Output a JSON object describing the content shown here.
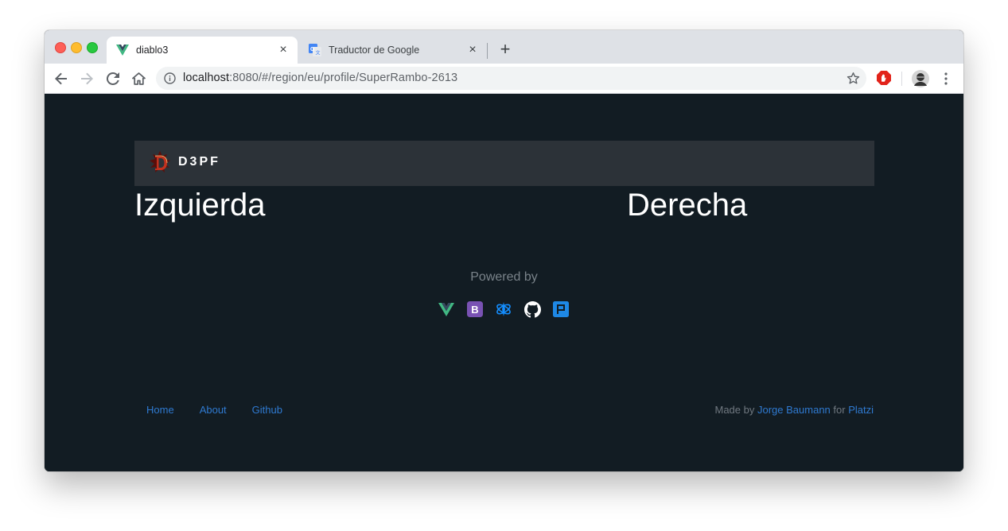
{
  "browser": {
    "tabs": [
      {
        "title": "diablo3",
        "favicon": "vue-icon",
        "active": true
      },
      {
        "title": "Traductor de Google",
        "favicon": "google-translate-icon",
        "active": false
      }
    ],
    "url": {
      "host": "localhost",
      "rest": ":8080/#/region/eu/profile/SuperRambo-2613"
    }
  },
  "navbar": {
    "brand": "D3PF",
    "logo": "diablo-logo-icon"
  },
  "columns": {
    "left": "Izquierda",
    "right": "Derecha"
  },
  "powered": {
    "label": "Powered by",
    "icons": [
      "vue-icon",
      "bootstrap-icon",
      "battlenet-icon",
      "github-icon",
      "platzi-icon"
    ]
  },
  "footer": {
    "links": [
      "Home",
      "About",
      "Github"
    ],
    "made_by": "Made by",
    "author": "Jorge Baumann",
    "for": "for",
    "org": "Platzi"
  },
  "colors": {
    "page_bg": "#121c23",
    "navbar_bg": "#2c3238",
    "link": "#2f7ad1",
    "vue_green": "#41b883",
    "bootstrap_purple": "#7952b3",
    "platzi_blue": "#1e88e5"
  }
}
